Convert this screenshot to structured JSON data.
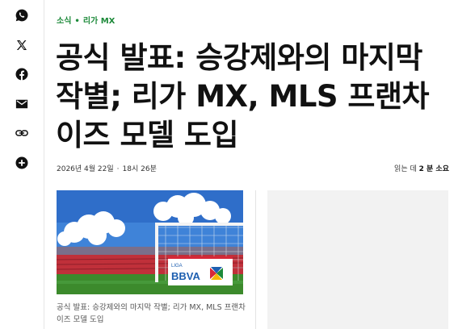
{
  "share": {
    "items": [
      {
        "name": "whatsapp-icon"
      },
      {
        "name": "x-icon"
      },
      {
        "name": "facebook-icon"
      },
      {
        "name": "email-icon"
      },
      {
        "name": "link-icon"
      },
      {
        "name": "more-icon"
      }
    ],
    "icon_color": "#111111"
  },
  "breadcrumb": {
    "section": "소식",
    "separator": "•",
    "league": "리가 MX",
    "color": "#1d8a3a"
  },
  "article": {
    "title": "공식 발표: 승강제와의 마지막 작별; 리가 MX, MLS 프랜차이즈 모델 도입",
    "date": "2026년 4월 22일",
    "time_separator": "·",
    "time": "18시 26분",
    "read_time": {
      "prefix": "읽는 데",
      "value": "2 분 소요"
    },
    "image": {
      "alt": "Stadium goal with LIGA BBVA MX board",
      "board_text": "LIGA",
      "board_brand": "BBVA"
    },
    "caption": "공식 발표: 승강제와의 마지막 작별; 리가 MX, MLS 프랜차이즈 모델 도입"
  }
}
